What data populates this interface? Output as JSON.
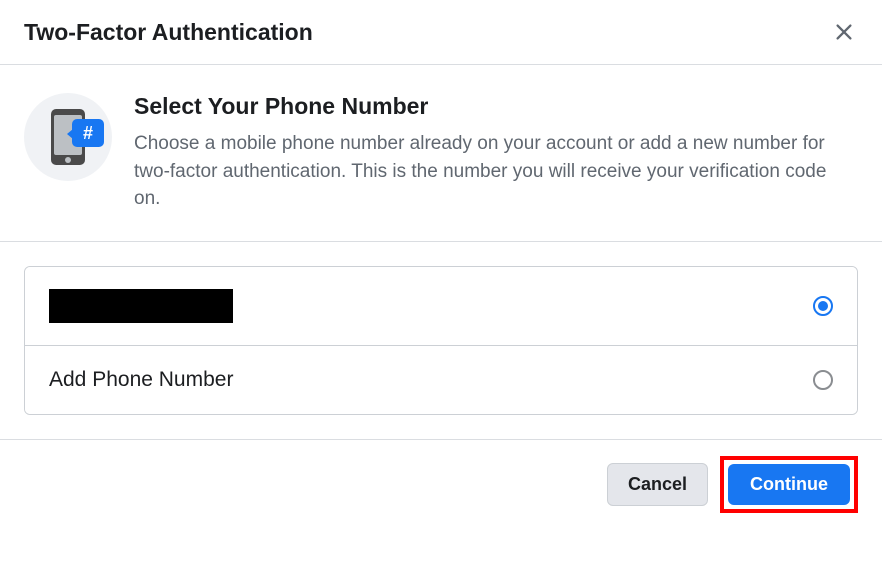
{
  "header": {
    "title": "Two-Factor Authentication"
  },
  "content": {
    "heading": "Select Your Phone Number",
    "description": "Choose a mobile phone number already on your account or add a new number for two-factor authentication. This is the number you will receive your verification code on."
  },
  "options": [
    {
      "label": "",
      "redacted": true,
      "selected": true
    },
    {
      "label": "Add Phone Number",
      "redacted": false,
      "selected": false
    }
  ],
  "footer": {
    "cancel_label": "Cancel",
    "continue_label": "Continue"
  }
}
